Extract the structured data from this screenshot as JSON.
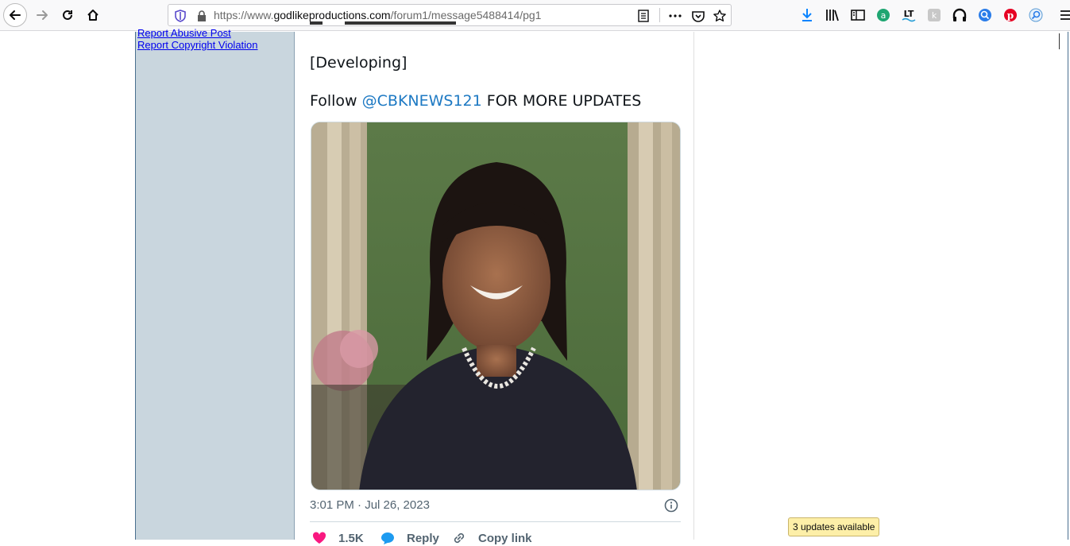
{
  "browser": {
    "url_prefix": "https://www.",
    "url_domain": "godlikeproductions.com",
    "url_path": "/forum1/message5488414/pg1",
    "update_notice": "3 updates available"
  },
  "sidebar": {
    "links": [
      "Report Abusive Post",
      "Report Copyright Violation"
    ]
  },
  "post": {
    "developing": "[Developing]",
    "follow_prefix": "Follow ",
    "follow_handle": "@CBKNEWS121",
    "follow_suffix": " FOR MORE UPDATES",
    "timestamp": "3:01 PM · Jul 26, 2023",
    "actions": {
      "likes": "1.5K",
      "reply": "Reply",
      "copy": "Copy link"
    }
  },
  "colors": {
    "accent_link": "#1d79c3",
    "like": "#f91880",
    "reply": "#1d9bf0"
  }
}
